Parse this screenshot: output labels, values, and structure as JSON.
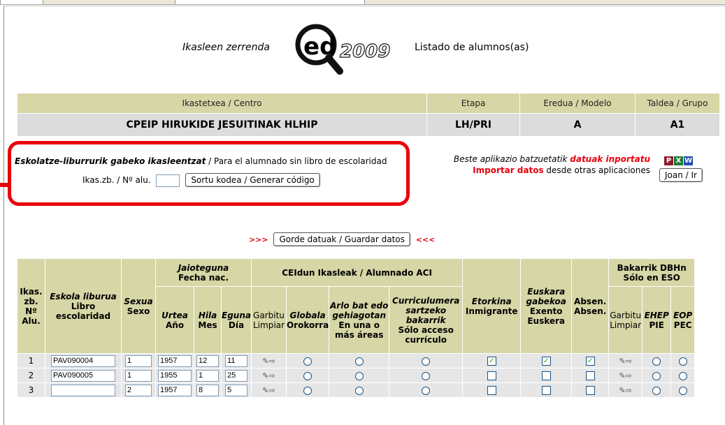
{
  "header": {
    "title_eu": "Ikasleen zerrenda",
    "title_es": "Listado de alumnos(as)",
    "logo_text": "ed",
    "logo_year": "2009"
  },
  "info": {
    "labels": [
      "Ikastetxea / Centro",
      "Etapa",
      "Eredua / Modelo",
      "Taldea / Grupo"
    ],
    "values": [
      "CPEIP HIRUKIDE JESUITINAK HLHIP",
      "LH/PRI",
      "A",
      "A1"
    ]
  },
  "no_book": {
    "text_eu": "Eskolatze-liburrurik gabeko ikasleentzat",
    "text_es": " / Para el alumnado sin libro de escolaridad",
    "field_label": "Ikas.zb. / Nº alu.",
    "field_value": "",
    "button": "Sortu kodea / Generar código"
  },
  "import": {
    "line1_pre": "Beste aplikazio batzuetatik ",
    "line1_red": "datuak inportatu",
    "line2_red": "Importar datos",
    "line2_post": " desde otras aplicaciones",
    "formats": [
      "pdf-icon",
      "excel-icon",
      "word-icon"
    ],
    "go_button": "Joan / Ir"
  },
  "save": {
    "left_arrows": ">>>",
    "button": "Gorde datuak / Guardar datos",
    "right_arrows": "<<<"
  },
  "table": {
    "h_ikas": "Ikas. zb. Nº Alu.",
    "h_eskola_eu": "Eskola liburua",
    "h_eskola_es": "Libro escolaridad",
    "h_sexua_eu": "Sexua",
    "h_sexua_es": "Sexo",
    "h_jaio_eu": "Jaioteguna",
    "h_jaio_es": "Fecha nac.",
    "h_urtea": "Urtea",
    "h_ano": "Año",
    "h_hila": "Hila",
    "h_mes": "Mes",
    "h_eguna": "Eguna",
    "h_dia": "Día",
    "h_ceid": "CEIdun Ikasleak / Alumnado ACI",
    "h_garbitu": "Garbitu",
    "h_limpiar": "Limpiar",
    "h_globala": "Globala",
    "h_orokorra": "Orokorra",
    "h_arlo": "Arlo bat edo gehiagotan",
    "h_arlo_es": "En una o más áreas",
    "h_curr": "Curriculumera sartzeko bakarrik",
    "h_curr_es": "Sólo acceso currículo",
    "h_etorkina": "Etorkina",
    "h_inmigrante": "Inmigrante",
    "h_euskara": "Euskara gabekoa",
    "h_exento": "Exento Euskera",
    "h_absen1": "Absen.",
    "h_absen2": "Absen.",
    "h_bakarrik": "Bakarrik DBHn",
    "h_soloeso": "Sólo en ESO",
    "h_garbitu2": "Garbitu",
    "h_limpiar2": "Limpiar",
    "h_ehep": "EHEP",
    "h_pie": "PIE",
    "h_eop": "EOP",
    "h_pec": "PEC",
    "rows": [
      {
        "n": "1",
        "libro": "PAV090004",
        "sexo": "1",
        "ano": "1957",
        "mes": "12",
        "dia": "11",
        "inmigrante": true,
        "exento": true,
        "absen": true
      },
      {
        "n": "2",
        "libro": "PAV090005",
        "sexo": "1",
        "ano": "1955",
        "mes": "1",
        "dia": "25",
        "inmigrante": false,
        "exento": false,
        "absen": false
      },
      {
        "n": "3",
        "libro": "",
        "sexo": "2",
        "ano": "1957",
        "mes": "8",
        "dia": "5",
        "inmigrante": false,
        "exento": false,
        "absen": false
      }
    ]
  }
}
